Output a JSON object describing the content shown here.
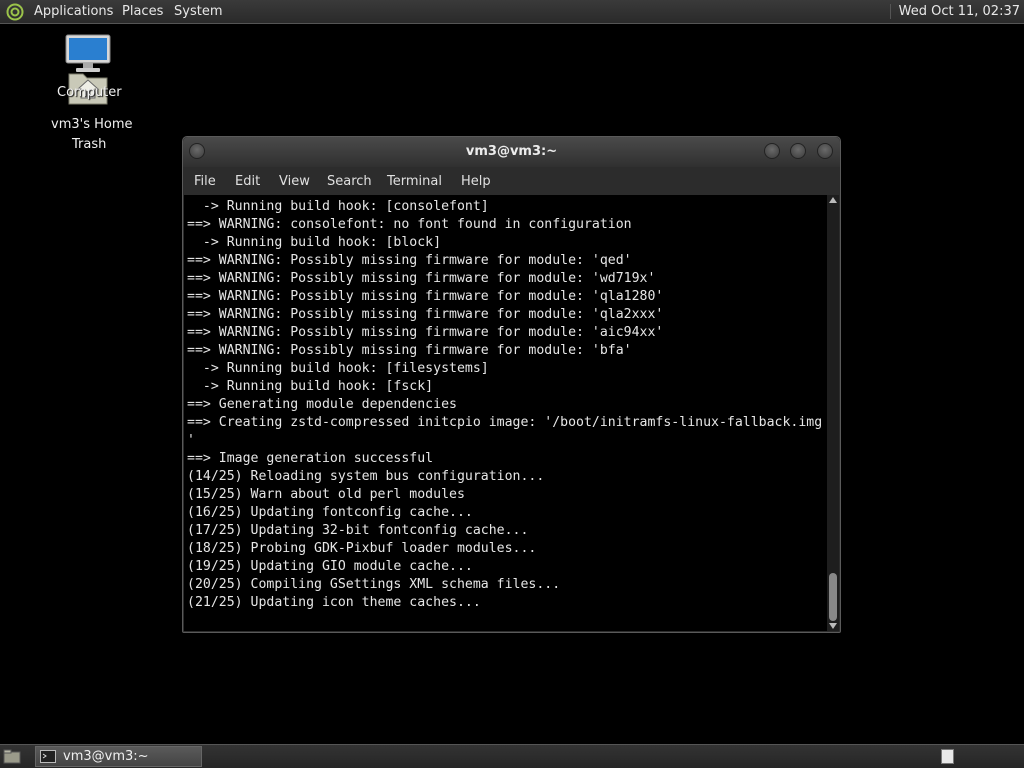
{
  "top_panel": {
    "applications_label": "Applications",
    "places_label": "Places",
    "system_label": "System",
    "clock": "Wed Oct 11, 02:37"
  },
  "desktop": {
    "icons": [
      {
        "label": "Computer",
        "icon": "computer-icon"
      },
      {
        "label": "vm3's Home",
        "icon": "home-folder-icon"
      },
      {
        "label": "Trash",
        "icon": "trash-icon"
      }
    ]
  },
  "terminal": {
    "title": "vm3@vm3:~",
    "menu": [
      "File",
      "Edit",
      "View",
      "Search",
      "Terminal",
      "Help"
    ],
    "lines": [
      "  -> Running build hook: [consolefont]",
      "==> WARNING: consolefont: no font found in configuration",
      "  -> Running build hook: [block]",
      "==> WARNING: Possibly missing firmware for module: 'qed'",
      "==> WARNING: Possibly missing firmware for module: 'wd719x'",
      "==> WARNING: Possibly missing firmware for module: 'qla1280'",
      "==> WARNING: Possibly missing firmware for module: 'qla2xxx'",
      "==> WARNING: Possibly missing firmware for module: 'aic94xx'",
      "==> WARNING: Possibly missing firmware for module: 'bfa'",
      "  -> Running build hook: [filesystems]",
      "  -> Running build hook: [fsck]",
      "==> Generating module dependencies",
      "==> Creating zstd-compressed initcpio image: '/boot/initramfs-linux-fallback.img",
      "'",
      "==> Image generation successful",
      "(14/25) Reloading system bus configuration...",
      "(15/25) Warn about old perl modules",
      "(16/25) Updating fontconfig cache...",
      "(17/25) Updating 32-bit fontconfig cache...",
      "(18/25) Probing GDK-Pixbuf loader modules...",
      "(19/25) Updating GIO module cache...",
      "(20/25) Compiling GSettings XML schema files...",
      "(21/25) Updating icon theme caches..."
    ]
  },
  "taskbar": {
    "task_label": "vm3@vm3:~",
    "task_icon": "terminal-icon"
  },
  "colors": {
    "panel": "#2e2e2e",
    "terminal_bg": "#000000",
    "terminal_fg": "#e6e6e6",
    "desktop_bg": "#000000"
  }
}
